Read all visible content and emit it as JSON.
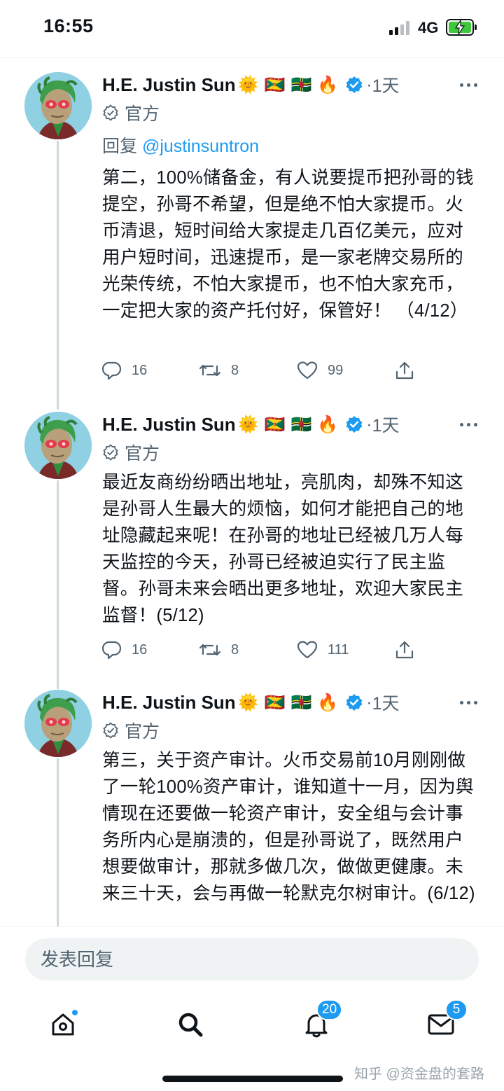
{
  "status_bar": {
    "time": "16:55",
    "network": "4G"
  },
  "tweets": [
    {
      "author": "H.E. Justin Sun",
      "name_emojis": [
        "🌞",
        "🇬🇩",
        "🇩🇲",
        "🔥"
      ],
      "time": "1天",
      "label": "官方",
      "reply_prefix": "回复 ",
      "reply_handle": "@justinsuntron",
      "text": "第二，100%储备金，有人说要提币把孙哥的钱提空，孙哥不希望，但是绝不怕大家提币。火币清退，短时间给大家提走几百亿美元，应对用户短时间，迅速提币，是一家老牌交易所的光荣传统，不怕大家提币，也不怕大家充币，一定把大家的资产托付好，保管好！ （4/12）",
      "replies": "16",
      "retweets": "8",
      "likes": "99"
    },
    {
      "author": "H.E. Justin Sun",
      "name_emojis": [
        "🌞",
        "🇬🇩",
        "🇩🇲",
        "🔥"
      ],
      "time": "1天",
      "label": "官方",
      "text": "最近友商纷纷晒出地址，亮肌肉，却殊不知这是孙哥人生最大的烦恼，如何才能把自己的地址隐藏起来呢！在孙哥的地址已经被几万人每天监控的今天，孙哥已经被迫实行了民主监督。孙哥未来会晒出更多地址，欢迎大家民主监督！(5/12)",
      "replies": "16",
      "retweets": "8",
      "likes": "111"
    },
    {
      "author": "H.E. Justin Sun",
      "name_emojis": [
        "🌞",
        "🇬🇩",
        "🇩🇲",
        "🔥"
      ],
      "time": "1天",
      "label": "官方",
      "text": "第三，关于资产审计。火币交易前10月刚刚做了一轮100%资产审计，谁知道十一月，因为舆情现在还要做一轮资产审计，安全组与会计事务所内心是崩溃的，但是孙哥说了，既然用户想要做审计，那就多做几次，做做更健康。未来三十天，会与再做一轮默克尔树审计。(6/12)"
    }
  ],
  "reply_bar": {
    "placeholder": "发表回复"
  },
  "bottom_nav": {
    "notifications_badge": "20",
    "messages_badge": "5"
  },
  "watermark": "知乎 @资金盘的套路",
  "colors": {
    "accent": "#1d9bf0",
    "secondary_text": "#536471",
    "primary_text": "#0f1419"
  }
}
